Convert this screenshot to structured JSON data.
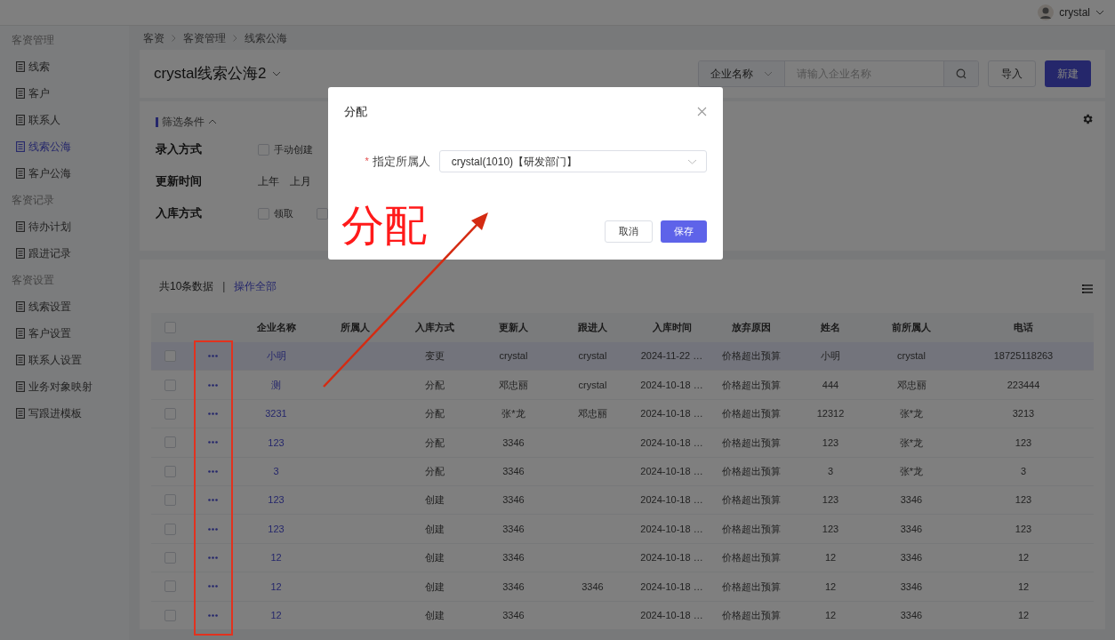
{
  "top_bar": {
    "user": "crystal"
  },
  "sidebar": {
    "sections": [
      {
        "title": "客资管理",
        "items": [
          {
            "label": "线索",
            "selected": false
          },
          {
            "label": "客户",
            "selected": false
          },
          {
            "label": "联系人",
            "selected": false
          },
          {
            "label": "线索公海",
            "selected": true
          },
          {
            "label": "客户公海",
            "selected": false
          }
        ]
      },
      {
        "title": "客资记录",
        "items": [
          {
            "label": "待办计划",
            "selected": false
          },
          {
            "label": "跟进记录",
            "selected": false
          }
        ]
      },
      {
        "title": "客资设置",
        "items": [
          {
            "label": "线索设置",
            "selected": false
          },
          {
            "label": "客户设置",
            "selected": false
          },
          {
            "label": "联系人设置",
            "selected": false
          },
          {
            "label": "业务对象映射",
            "selected": false
          },
          {
            "label": "写跟进模板",
            "selected": false
          }
        ]
      }
    ]
  },
  "breadcrumb": [
    "客资",
    "客资管理",
    "线索公海"
  ],
  "header": {
    "title": "crystal线索公海2",
    "search_type": "企业名称",
    "search_placeholder": "请输入企业名称",
    "buttons": [
      {
        "label": "导入",
        "primary": false
      },
      {
        "label": "新建",
        "primary": true
      }
    ]
  },
  "filters": {
    "title": "筛选条件",
    "expanded": true,
    "rows": [
      {
        "label": "录入方式",
        "kind": "checkbox",
        "options": [
          {
            "label": "手动创建",
            "checked": false
          }
        ]
      },
      {
        "label": "更新时间",
        "kind": "text",
        "options": [
          {
            "label": "上年"
          },
          {
            "label": "上月"
          }
        ]
      },
      {
        "label": "入库方式",
        "kind": "checkbox",
        "options": [
          {
            "label": "领取",
            "checked": false
          },
          {
            "checked": false
          }
        ]
      }
    ]
  },
  "table": {
    "total": "共10条数据",
    "separator": "|",
    "bulk_action": "操作全部",
    "all_checked": false,
    "columns": [
      "企业名称",
      "所属人",
      "入库方式",
      "更新人",
      "跟进人",
      "入库时间",
      "放弃原因",
      "姓名",
      "前所属人",
      "电话"
    ],
    "rows": [
      {
        "checked": false,
        "highlighted": true,
        "cells": [
          "小明",
          null,
          "变更",
          "crystal",
          "crystal",
          "2024-11-22 …",
          "价格超出预算",
          "小明",
          "crystal",
          "18725118263"
        ]
      },
      {
        "checked": false,
        "highlighted": false,
        "cells": [
          "测",
          null,
          "分配",
          "邓忠丽",
          "crystal",
          "2024-10-18 …",
          "价格超出预算",
          "444",
          "邓忠丽",
          "223444"
        ]
      },
      {
        "checked": false,
        "highlighted": false,
        "cells": [
          "3231",
          null,
          "分配",
          "张*龙",
          "邓忠丽",
          "2024-10-18 …",
          "价格超出预算",
          "12312",
          "张*龙",
          "3213"
        ]
      },
      {
        "checked": false,
        "highlighted": false,
        "cells": [
          "123",
          null,
          "分配",
          "3346",
          null,
          "2024-10-18 …",
          "价格超出预算",
          "123",
          "张*龙",
          "123"
        ]
      },
      {
        "checked": false,
        "highlighted": false,
        "cells": [
          "3",
          null,
          "分配",
          "3346",
          null,
          "2024-10-18 …",
          "价格超出预算",
          "3",
          "张*龙",
          "3"
        ]
      },
      {
        "checked": false,
        "highlighted": false,
        "cells": [
          "123",
          null,
          "创建",
          "3346",
          null,
          "2024-10-18 …",
          "价格超出预算",
          "123",
          "3346",
          "123"
        ]
      },
      {
        "checked": false,
        "highlighted": false,
        "cells": [
          "123",
          null,
          "创建",
          "3346",
          null,
          "2024-10-18 …",
          "价格超出预算",
          "123",
          "3346",
          "123"
        ]
      },
      {
        "checked": false,
        "highlighted": false,
        "cells": [
          "12",
          null,
          "创建",
          "3346",
          null,
          "2024-10-18 …",
          "价格超出预算",
          "12",
          "3346",
          "12"
        ]
      },
      {
        "checked": false,
        "highlighted": false,
        "cells": [
          "12",
          null,
          "创建",
          "3346",
          "3346",
          "2024-10-18 …",
          "价格超出预算",
          "12",
          "3346",
          "12"
        ]
      },
      {
        "checked": false,
        "highlighted": false,
        "cells": [
          "12",
          null,
          "创建",
          "3346",
          null,
          "2024-10-18 …",
          "价格超出预算",
          "12",
          "3346",
          "12"
        ]
      }
    ]
  },
  "modal": {
    "title": "分配",
    "field": {
      "label": "指定所属人",
      "required_mark": "*",
      "value": "crystal(1010)【研发部门】"
    },
    "buttons": [
      {
        "label": "取消",
        "primary": false
      },
      {
        "label": "保存",
        "primary": true
      }
    ]
  },
  "annotation": {
    "text": "分配"
  }
}
